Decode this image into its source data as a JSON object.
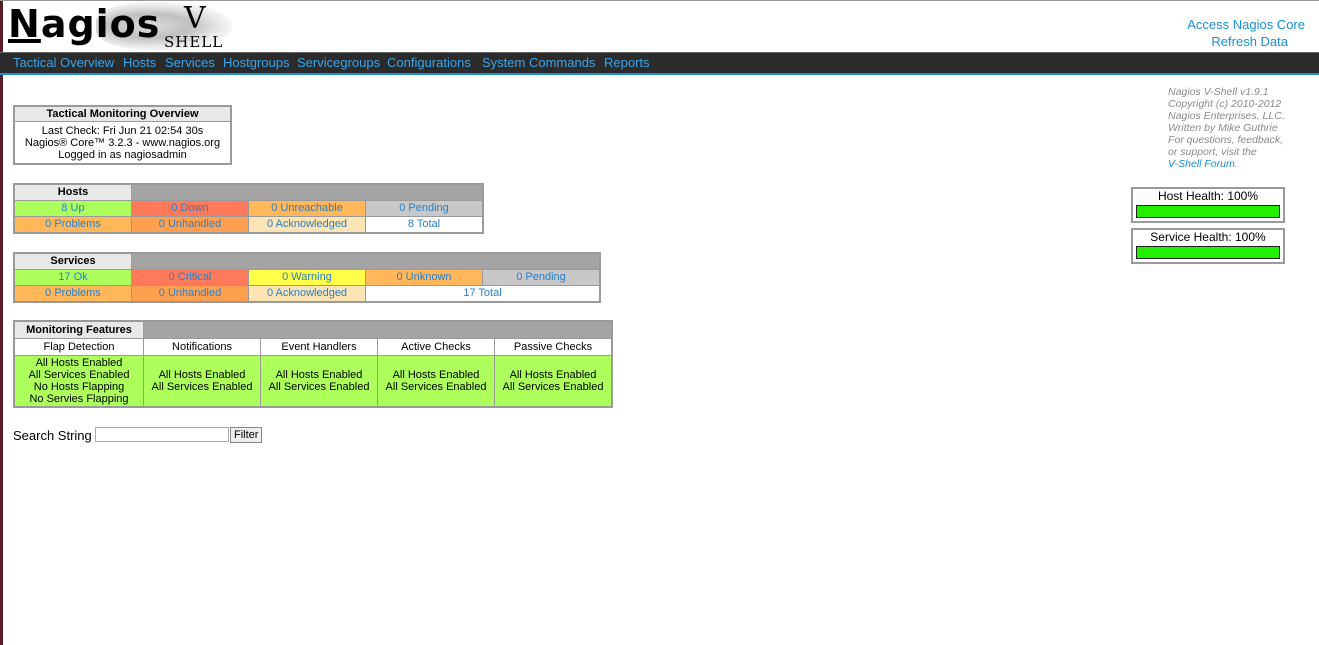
{
  "logo": {
    "word": "agios",
    "n": "N",
    "v": "V",
    "shell": "SHELL"
  },
  "toplinks": {
    "access": "Access Nagios Core",
    "refresh": "Refresh Data"
  },
  "nav": [
    "Tactical Overview",
    "Hosts",
    "Services",
    "Hostgroups",
    "Servicegroups",
    "Configurations",
    "System Commands",
    "Reports"
  ],
  "overview": {
    "title": "Tactical Monitoring Overview",
    "last_check": "Last Check: Fri Jun 21 02:54 30s",
    "core": "Nagios® Core™ 3.2.3 - www.nagios.org",
    "user": "Logged in as nagiosadmin"
  },
  "hosts": {
    "title": "Hosts",
    "up": "8 Up",
    "down": "0 Down",
    "unreachable": "0 Unreachable",
    "pending": "0 Pending",
    "problems": "0 Problems",
    "unhandled": "0 Unhandled",
    "acknowledged": "0 Acknowledged",
    "total": "8 Total"
  },
  "services": {
    "title": "Services",
    "ok": "17 Ok",
    "critical": "0 Critical",
    "warning": "0 Warning",
    "unknown": "0 Unknown",
    "pending": "0 Pending",
    "problems": "0 Problems",
    "unhandled": "0 Unhandled",
    "acknowledged": "0 Acknowledged",
    "total": "17 Total"
  },
  "features": {
    "title": "Monitoring Features",
    "columns": [
      "Flap Detection",
      "Notifications",
      "Event Handlers",
      "Active Checks",
      "Passive Checks"
    ],
    "flap": [
      "All Hosts Enabled",
      "All Services Enabled",
      "No Hosts Flapping",
      "No Servies Flapping"
    ],
    "cells": [
      [
        "All Hosts Enabled",
        "All Services Enabled"
      ],
      [
        "All Hosts Enabled",
        "All Services Enabled"
      ],
      [
        "All Hosts Enabled",
        "All Services Enabled"
      ],
      [
        "All Hosts Enabled",
        "All Services Enabled"
      ]
    ]
  },
  "search": {
    "label": "Search String",
    "value": "",
    "button": "Filter"
  },
  "info": {
    "lines": [
      "Nagios V-Shell v1.9.1",
      "Copyright (c) 2010-2012",
      "Nagios Enterprises, LLC.",
      "Written by Mike Guthrie",
      "For questions, feedback,",
      "or support, visit the"
    ],
    "link": "V-Shell Forum",
    "link_suffix": "."
  },
  "health": {
    "host": "Host Health: 100%",
    "host_value": 100,
    "service": "Service Health: 100%",
    "service_value": 100
  }
}
